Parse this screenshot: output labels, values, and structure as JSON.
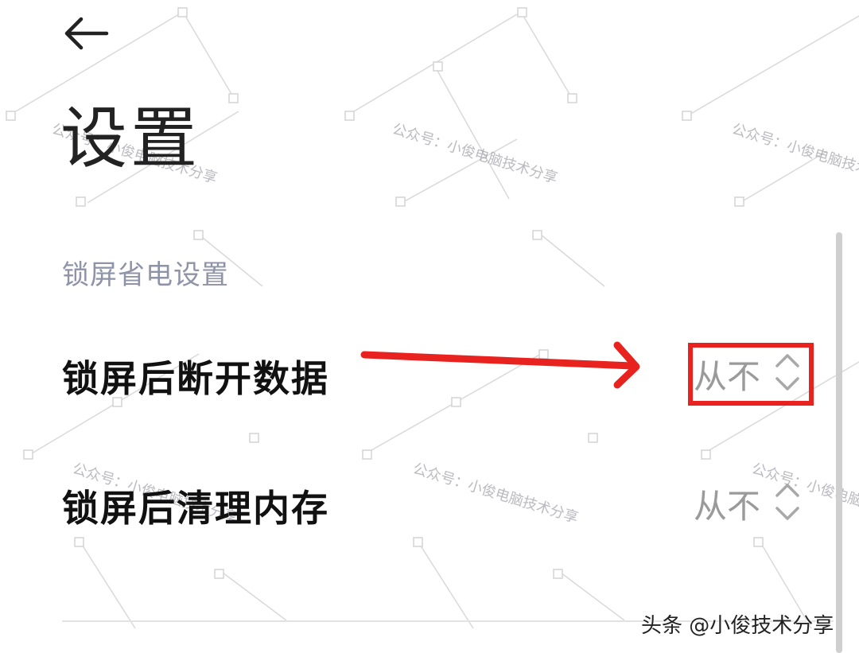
{
  "header": {
    "back_icon": "arrow-left-icon",
    "title": "设置"
  },
  "section": {
    "header": "锁屏省电设置"
  },
  "settings": [
    {
      "label": "锁屏后断开数据",
      "value": "从不",
      "icon": "chevron-up-down-icon"
    },
    {
      "label": "锁屏后清理内存",
      "value": "从不",
      "icon": "chevron-up-down-icon"
    }
  ],
  "annotation": {
    "highlight_color": "#e8231f",
    "arrow_color": "#e8231f"
  },
  "watermark": {
    "text": "公众号：小俊电脑技术分享"
  },
  "footer": {
    "credit": "头条 @小俊技术分享"
  }
}
